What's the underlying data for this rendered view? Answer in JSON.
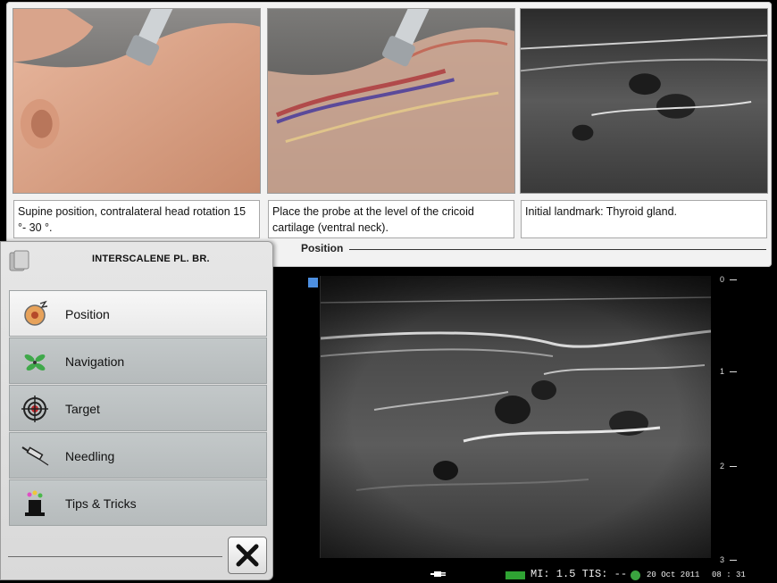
{
  "panel": {
    "captions": [
      "Supine position, contralateral head rotation 15 °- 30 °.",
      "Place the probe at the level of the cricoid cartilage (ventral neck).",
      "Initial landmark: Thyroid gland."
    ],
    "section_title": "Position"
  },
  "menu": {
    "title": "INTERSCALENE PL. BR.",
    "items": [
      {
        "label": "Position",
        "icon": "position-icon"
      },
      {
        "label": "Navigation",
        "icon": "navigation-icon"
      },
      {
        "label": "Target",
        "icon": "target-icon"
      },
      {
        "label": "Needling",
        "icon": "syringe-icon"
      },
      {
        "label": "Tips & Tricks",
        "icon": "magic-hat-icon"
      }
    ],
    "active_item": "Position",
    "close_icon": "close-icon"
  },
  "ultrasound": {
    "depth_labels": [
      "0",
      "1",
      "2",
      "3"
    ]
  },
  "status_bar": {
    "mi_tis": "MI: 1.5 TIS: --",
    "date": "20 Oct 2011",
    "time": "08 : 31"
  },
  "colors": {
    "accent_blue": "#4d8fe0",
    "status_green": "#2fa333",
    "menu_item_bg": "#bcc1c2"
  }
}
